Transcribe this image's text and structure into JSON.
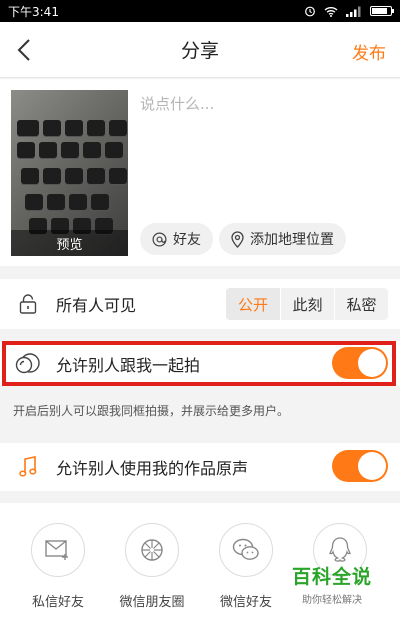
{
  "status_bar": {
    "time": "下午3:41",
    "battery_percent": 85,
    "icons": [
      "alarm-icon",
      "wifi-icon",
      "signal-icon",
      "battery-icon"
    ]
  },
  "header": {
    "back_icon": "chevron-left-icon",
    "title": "分享",
    "publish_label": "发布"
  },
  "compose": {
    "placeholder": "说点什么...",
    "preview_label": "预览",
    "friends_chip": {
      "icon": "at-icon",
      "label": "好友"
    },
    "location_chip": {
      "icon": "location-pin-icon",
      "label": "添加地理位置"
    }
  },
  "visibility": {
    "icon": "lock-icon",
    "label": "所有人可见",
    "options": [
      "公开",
      "此刻",
      "私密"
    ],
    "selected": "公开"
  },
  "shoot_together": {
    "icon": "duet-icon",
    "label": "允许别人跟我一起拍",
    "enabled": true,
    "hint": "开启后别人可以跟我同框拍摄，并展示给更多用户。"
  },
  "original_sound": {
    "icon": "music-note-icon",
    "label": "允许别人使用我的作品原声",
    "enabled": true
  },
  "share": {
    "items": [
      {
        "icon": "mail-icon",
        "label": "私信好友"
      },
      {
        "icon": "camera-aperture-icon",
        "label": "微信朋友圈"
      },
      {
        "icon": "wechat-icon",
        "label": "微信好友"
      },
      {
        "icon": "qq-icon",
        "label": ""
      }
    ]
  },
  "watermark": {
    "title": "百科全说",
    "subtitle": "助你轻松解决"
  },
  "colors": {
    "accent": "#ff7a16",
    "highlight_border": "#e0201b",
    "watermark_green": "#2aa52a"
  }
}
